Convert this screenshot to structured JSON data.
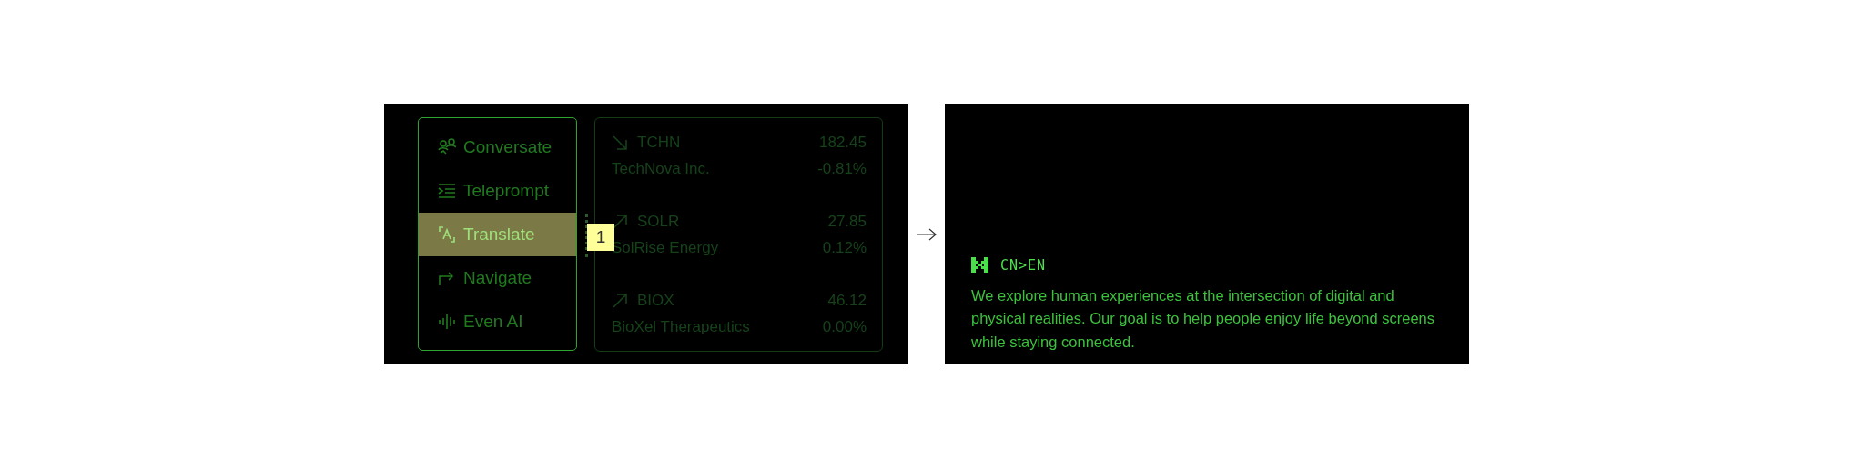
{
  "menu": {
    "items": [
      {
        "label": "Conversate",
        "selected": false
      },
      {
        "label": "Teleprompt",
        "selected": false
      },
      {
        "label": "Translate",
        "selected": true
      },
      {
        "label": "Navigate",
        "selected": false
      },
      {
        "label": "Even AI",
        "selected": false
      }
    ]
  },
  "stocks": [
    {
      "kind": "down",
      "ticker": "TCHN",
      "price": "182.45",
      "name": "TechNova Inc.",
      "change": "-0.81%"
    },
    {
      "kind": "up",
      "ticker": "SOLR",
      "price": "27.85",
      "name": "SolRise Energy",
      "change": "0.12%"
    },
    {
      "kind": "up",
      "ticker": "BIOX",
      "price": "46.12",
      "name": "BioXel Therapeutics",
      "change": "0.00%"
    }
  ],
  "annotation": {
    "label": "1"
  },
  "translation": {
    "language_pair": "CN>EN",
    "text": "We explore human experiences at the intersection of digital and physical realities. Our goal is to help people enjoy life beyond screens while staying connected."
  }
}
